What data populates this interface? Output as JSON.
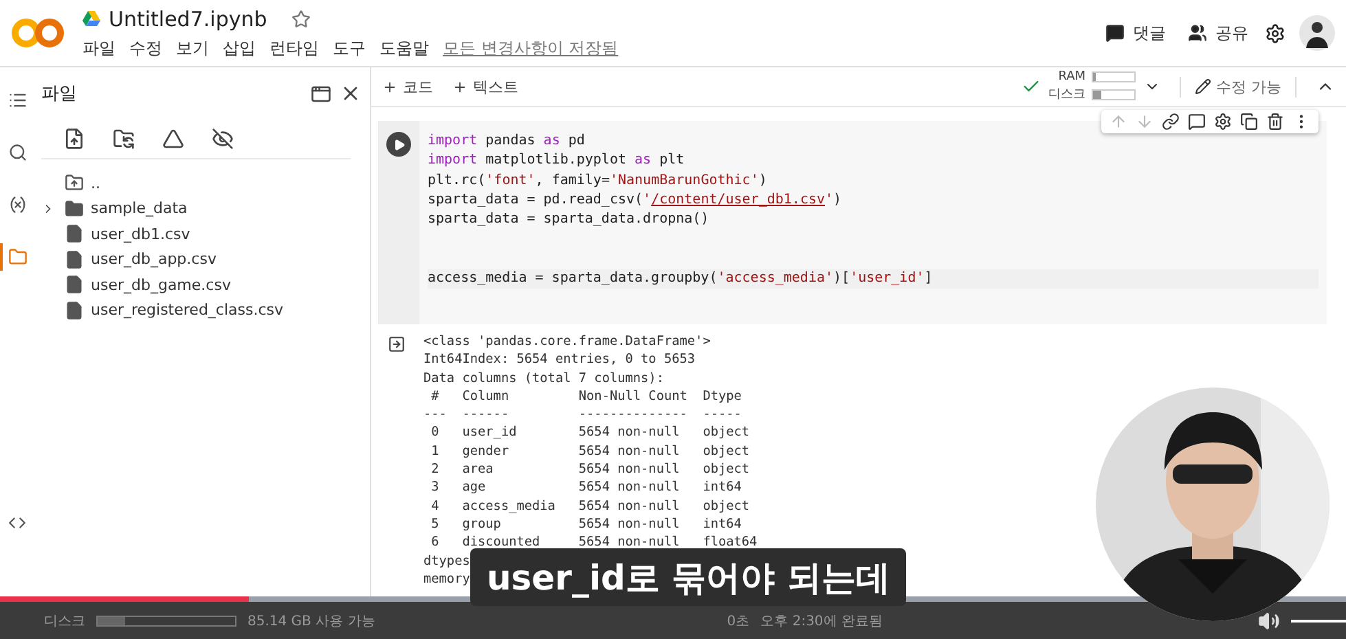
{
  "header": {
    "file_name": "Untitled7.ipynb",
    "starred": false,
    "menu": [
      "파일",
      "수정",
      "보기",
      "삽입",
      "런타임",
      "도구",
      "도움말"
    ],
    "save_status": "모든 변경사항이 저장됨",
    "actions": [
      {
        "kind": "comment",
        "label": "댓글"
      },
      {
        "kind": "share",
        "label": "공유"
      }
    ]
  },
  "toolbar": {
    "add_buttons": [
      "코드",
      "텍스트"
    ],
    "ram": {
      "label": "RAM",
      "level": 0.08
    },
    "disk": {
      "label": "디스크",
      "level": 0.2
    },
    "edit_mode": "수정 가능"
  },
  "rail": [
    {
      "kind": "toc",
      "selected": false
    },
    {
      "kind": "search",
      "selected": false
    },
    {
      "kind": "variables",
      "selected": false
    },
    {
      "kind": "files",
      "selected": true
    }
  ],
  "sidebar": {
    "title": "파일",
    "files": [
      {
        "name": "..",
        "kind": "parent"
      },
      {
        "name": "sample_data",
        "kind": "folder",
        "expanded": false
      },
      {
        "name": "user_db1.csv",
        "kind": "file"
      },
      {
        "name": "user_db_app.csv",
        "kind": "file"
      },
      {
        "name": "user_db_game.csv",
        "kind": "file"
      },
      {
        "name": "user_registered_class.csv",
        "kind": "file"
      }
    ]
  },
  "cell": {
    "code_lines": [
      {
        "kind": "code",
        "tokens": [
          {
            "text": "import",
            "kind": "keyword"
          },
          {
            "text": " pandas ",
            "kind": "plain"
          },
          {
            "text": "as",
            "kind": "keyword"
          },
          {
            "text": " pd",
            "kind": "plain"
          }
        ]
      },
      {
        "kind": "code",
        "tokens": [
          {
            "text": "import",
            "kind": "keyword"
          },
          {
            "text": " matplotlib.pyplot ",
            "kind": "plain"
          },
          {
            "text": "as",
            "kind": "keyword"
          },
          {
            "text": " plt",
            "kind": "plain"
          }
        ]
      },
      {
        "kind": "code",
        "tokens": [
          {
            "text": "plt.rc(",
            "kind": "plain"
          },
          {
            "text": "'font'",
            "kind": "string"
          },
          {
            "text": ", family=",
            "kind": "plain"
          },
          {
            "text": "'NanumBarunGothic'",
            "kind": "string"
          },
          {
            "text": ")",
            "kind": "plain"
          }
        ]
      },
      {
        "kind": "code",
        "tokens": [
          {
            "text": "sparta_data = pd.read_csv(",
            "kind": "plain"
          },
          {
            "text": "'",
            "kind": "string"
          },
          {
            "text": "/content/user_db1.csv",
            "kind": "link"
          },
          {
            "text": "'",
            "kind": "string"
          },
          {
            "text": ")",
            "kind": "plain"
          }
        ]
      },
      {
        "kind": "code",
        "tokens": [
          {
            "text": "sparta_data = sparta_data.dropna()",
            "kind": "plain"
          }
        ]
      },
      {
        "kind": "blank"
      },
      {
        "kind": "blank"
      },
      {
        "kind": "code",
        "tokens": [
          {
            "text": "access_media = sparta_data.groupby(",
            "kind": "plain"
          },
          {
            "text": "'access_media'",
            "kind": "string"
          },
          {
            "text": ")[",
            "kind": "plain"
          },
          {
            "text": "'user_id'",
            "kind": "string"
          },
          {
            "text": "]",
            "kind": "plain"
          }
        ]
      }
    ]
  },
  "output": {
    "lines": [
      "<class 'pandas.core.frame.DataFrame'>",
      "Int64Index: 5654 entries, 0 to 5653",
      "Data columns (total 7 columns):",
      " #   Column         Non-Null Count  Dtype  ",
      "---  ------         --------------  -----  ",
      " 0   user_id        5654 non-null   object ",
      " 1   gender         5654 non-null   object ",
      " 2   area           5654 non-null   object ",
      " 3   age            5654 non-null   int64  ",
      " 4   access_media   5654 non-null   object ",
      " 5   group          5654 non-null   int64  ",
      " 6   discounted     5654 non-null   float64",
      "dtypes",
      "memory"
    ]
  },
  "status": {
    "disk_label": "디스크",
    "disk_free": "85.14 GB 사용 가능",
    "run_time": "0초",
    "completed": "오후 2:30에 완료됨"
  },
  "video": {
    "subtitle": "user_id로 묶어야 되는데",
    "progress": {
      "level": 0.185
    },
    "volume": {
      "level": 1
    }
  }
}
